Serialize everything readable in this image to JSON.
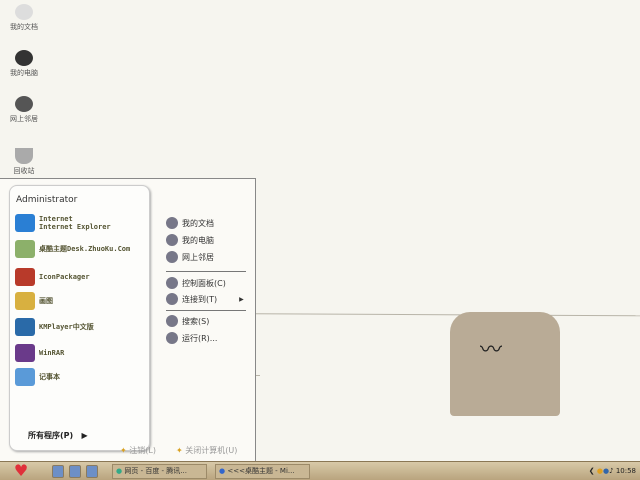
{
  "desktop": {
    "icons": [
      {
        "label": "我的文档"
      },
      {
        "label": "我的电脑"
      },
      {
        "label": "网上邻居"
      },
      {
        "label": "回收站"
      }
    ]
  },
  "start_menu": {
    "user": "Administrator",
    "programs": [
      {
        "label": "Internet\nInternet Explorer",
        "icon": "ie-icon",
        "color": "#2a7fd4"
      },
      {
        "label": "桌酷主题Desk.ZhuoKu.Com",
        "icon": "zhuoku-icon",
        "color": "#8cb06a"
      },
      {
        "label": "IconPackager",
        "icon": "iconpackager-icon",
        "color": "#b83a2a"
      },
      {
        "label": "画图",
        "icon": "paint-icon",
        "color": "#d8b040"
      },
      {
        "label": "KMPlayer中文版",
        "icon": "kmplayer-icon",
        "color": "#2a6aa8"
      },
      {
        "label": "WinRAR",
        "icon": "winrar-icon",
        "color": "#6a3a8a"
      },
      {
        "label": "记事本",
        "icon": "notepad-icon",
        "color": "#5a9ad8"
      }
    ],
    "all_programs": "所有程序(P)",
    "places": [
      {
        "label": "我的文档",
        "icon": "my-documents-icon"
      },
      {
        "label": "我的电脑",
        "icon": "my-computer-icon"
      },
      {
        "label": "网上邻居",
        "icon": "network-icon"
      },
      {
        "label": "控制面板(C)",
        "icon": "control-panel-icon"
      },
      {
        "label": "连接到(T)",
        "icon": "connect-icon"
      },
      {
        "label": "搜索(S)",
        "icon": "search-icon"
      },
      {
        "label": "运行(R)...",
        "icon": "run-icon"
      }
    ],
    "logoff": "注销(L)",
    "shutdown": "关闭计算机(U)"
  },
  "taskbar": {
    "tasks": [
      {
        "label": "网页 - 百度 - 腾讯..."
      },
      {
        "label": "<<<桌酷主题 - Mi..."
      }
    ],
    "clock": "10:58"
  }
}
